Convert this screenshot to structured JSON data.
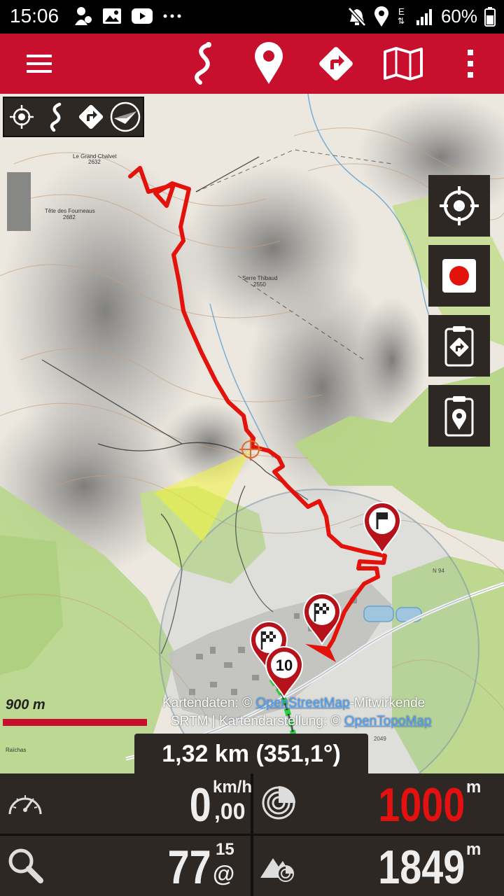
{
  "status_bar": {
    "time": "15:06",
    "battery": "60%",
    "network": "E",
    "icons_left": [
      "location-person-icon",
      "image-icon",
      "youtube-icon",
      "more-dots-icon"
    ],
    "icons_right": [
      "mute-icon",
      "location-icon",
      "network-icon",
      "signal-icon",
      "battery-icon"
    ]
  },
  "app_bar": {
    "accent_color": "#c8102e",
    "buttons": [
      "menu-icon",
      "track-icon",
      "waypoint-icon",
      "route-icon",
      "map-icon",
      "overflow-menu-icon"
    ]
  },
  "map": {
    "mini_toolbar": [
      "crosshair-icon",
      "track-icon",
      "route-icon",
      "compass-icon"
    ],
    "side_buttons": [
      "center-location-icon",
      "record-icon",
      "route-clipboard-icon",
      "waypoint-clipboard-icon"
    ],
    "scale_label": "900 m",
    "place_labels": [
      "Le Grand Chalvet",
      "2632",
      "Tête des Fourneaus",
      "2682",
      "Serre Thibaud",
      "2550",
      "N 94",
      "2049",
      "Raïchas"
    ],
    "attribution": {
      "prefix": "Kartendaten: ©",
      "osm_link": "OpenStreetMap",
      "osm_suffix": "-Mitwirkende",
      "line2_prefix": "SRTM | Kartendarstellung: ©",
      "otm_link": "OpenTopoMap"
    },
    "markers": [
      "flag-marker",
      "checkered-flag-marker",
      "checkered-flag-marker",
      "number-marker"
    ],
    "marker_number": "10",
    "distance_readout": "1,32 km (351,1°)"
  },
  "dashboard": {
    "speed": {
      "icon": "speedometer-icon",
      "value": "0",
      "unit": "km/h",
      "decimal": ",00"
    },
    "accuracy": {
      "icon": "gps-accuracy-icon",
      "value": "1000",
      "unit": "m",
      "color": "#e51010"
    },
    "zoom": {
      "icon": "zoom-icon",
      "value": "77",
      "sup": "15",
      "sub": "@"
    },
    "altitude": {
      "icon": "altitude-icon",
      "value": "1849",
      "unit": "m"
    }
  }
}
